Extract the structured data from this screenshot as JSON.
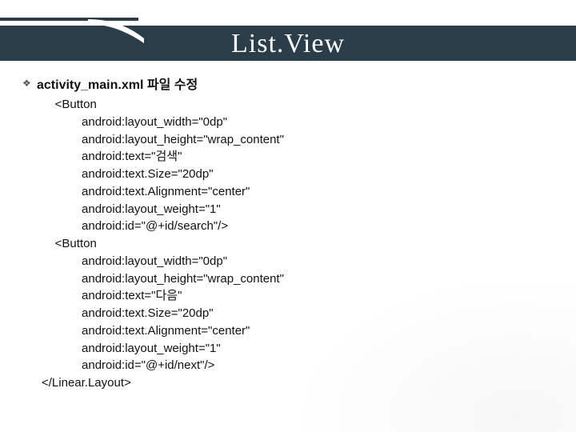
{
  "title": "List.View",
  "bullet_icon": "❖",
  "heading": "activity_main.xml 파일 수정",
  "code_lines": [
    "<Button",
    "    android:layout_width=\"0dp\"",
    "    android:layout_height=\"wrap_content\"",
    "    android:text=\"검색\"",
    "    android:text.Size=\"20dp\"",
    "    android:text.Alignment=\"center\"",
    "    android:layout_weight=\"1\"",
    "    android:id=\"@+id/search\"/>",
    "<Button",
    "    android:layout_width=\"0dp\"",
    "    android:layout_height=\"wrap_content\"",
    "    android:text=\"다음\"",
    "    android:text.Size=\"20dp\"",
    "    android:text.Alignment=\"center\"",
    "    android:layout_weight=\"1\"",
    "    android:id=\"@+id/next\"/>",
    "</Linear.Layout>"
  ],
  "code_indent": [
    1,
    2,
    2,
    2,
    2,
    2,
    2,
    2,
    1,
    2,
    2,
    2,
    2,
    2,
    2,
    2,
    0
  ]
}
